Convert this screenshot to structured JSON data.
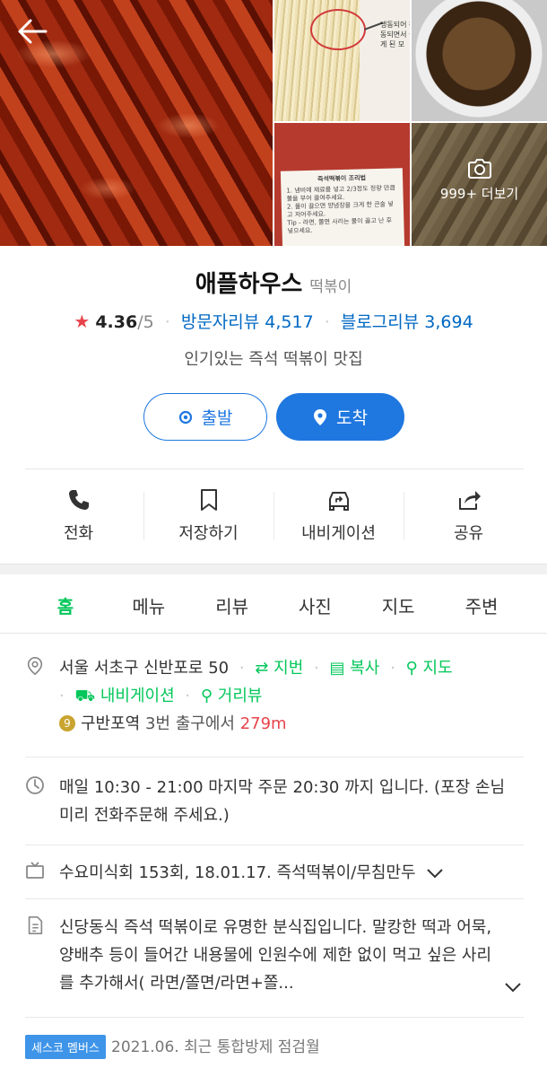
{
  "photos": {
    "noodle_note": "냉동되어 해동되면서 붙게 된 모",
    "recipe_title": "즉석떡볶이 조리법",
    "recipe_lines": [
      "1. 냄비에 재료를 넣고 2/3정도 정량 만큼 물을 부어 끓여주세요.",
      "2. 물이 끓으면 양념장을 크게 한 큰술 넣고 저어주세요.",
      "Tip - 라면, 쫄면 사리는 물이 끓고 난 후 넣으세요."
    ],
    "more_label": "999+ 더보기",
    "more_icon": "camera-icon"
  },
  "place": {
    "name": "애플하우스",
    "category": "떡볶이",
    "star": "★",
    "rating": "4.36",
    "rating_max": "/5",
    "visit_review_label": "방문자리뷰 4,517",
    "blog_review_label": "블로그리뷰 3,694",
    "tagline": "인기있는 즉석 떡볶이 맛집"
  },
  "route_buttons": {
    "depart": "출발",
    "arrive": "도착"
  },
  "actions": [
    {
      "label": "전화",
      "icon": "phone-icon"
    },
    {
      "label": "저장하기",
      "icon": "bookmark-icon"
    },
    {
      "label": "내비게이션",
      "icon": "car-navigation-icon"
    },
    {
      "label": "공유",
      "icon": "share-icon"
    }
  ],
  "tabs": [
    "홈",
    "메뉴",
    "리뷰",
    "사진",
    "지도",
    "주변"
  ],
  "active_tab": "홈",
  "address": {
    "text": "서울 서초구 신반포로 50",
    "jibun": "지번",
    "copy": "복사",
    "map": "지도",
    "navigation": "내비게이션",
    "street_view": "거리뷰"
  },
  "subway": {
    "line": "9",
    "station": "구반포역",
    "exit_text": "3번 출구에서",
    "distance": "279m"
  },
  "hours": "매일 10:30 - 21:00 마지막 주문 20:30 까지 입니다. (포장 손님 미리 전화주문해 주세요.)",
  "tv": "수요미식회 153회, 18.01.17. 즉석떡볶이/무침만두",
  "description": "신당동식 즉석 떡볶이로 유명한 분식집입니다. 말캉한 떡과 어묵, 양배추 등이 들어간 내용물에 인원수에 제한 없이 먹고 싶은 사리를 추가해서( 라면/쫄면/라면+쫄...",
  "inspection": {
    "badge": "세스코 멤버스",
    "text": "2021.06. 최근 통합방제 점검월"
  },
  "colors": {
    "accent_green": "#03c75a",
    "link_blue": "#0068c3",
    "button_blue": "#1f77e0",
    "star_red": "#e8434b"
  }
}
